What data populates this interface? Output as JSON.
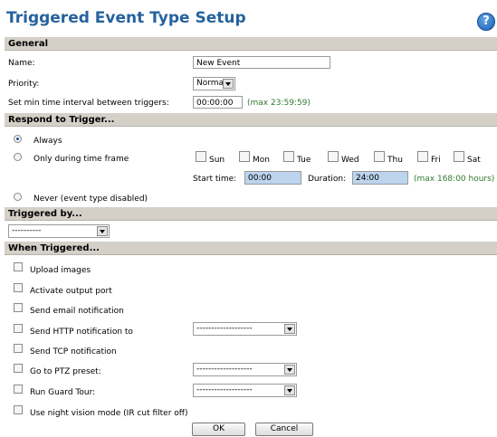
{
  "title": "Triggered Event Type Setup",
  "help_label": "?",
  "general": {
    "header": "General",
    "name_label": "Name:",
    "name_value": "New Event",
    "priority_label": "Priority:",
    "priority_value": "Normal",
    "interval_label": "Set min time interval between triggers:",
    "interval_value": "00:00:00",
    "interval_hint": "(max 23:59:59)"
  },
  "respond": {
    "header": "Respond to Trigger...",
    "always_label": "Always",
    "timeframe_label": "Only during time frame",
    "days": [
      "Sun",
      "Mon",
      "Tue",
      "Wed",
      "Thu",
      "Fri",
      "Sat"
    ],
    "start_label": "Start time:",
    "start_value": "00:00",
    "duration_label": "Duration:",
    "duration_value": "24:00",
    "duration_hint": "(max 168:00 hours)",
    "never_label": "Never (event type disabled)"
  },
  "triggered_by": {
    "header": "Triggered by...",
    "value": "----------"
  },
  "when": {
    "header": "When Triggered...",
    "upload": "Upload images",
    "output": "Activate output port",
    "email": "Send email notification",
    "http": "Send HTTP notification to",
    "http_value": "-------------------",
    "tcp": "Send TCP notification",
    "ptz": "Go to PTZ preset:",
    "ptz_value": "-------------------",
    "guard": "Run Guard Tour:",
    "guard_value": "-------------------",
    "night": "Use night vision mode (IR cut filter off)"
  },
  "buttons": {
    "ok": "OK",
    "cancel": "Cancel"
  }
}
